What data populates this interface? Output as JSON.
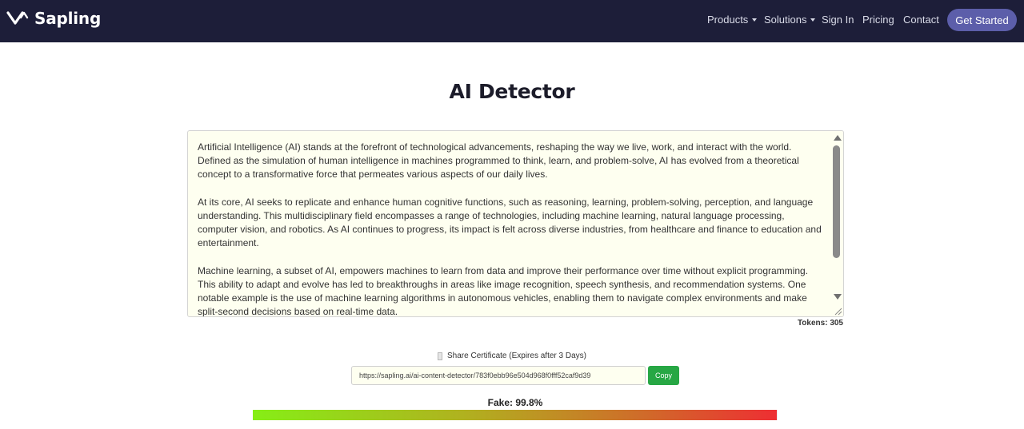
{
  "navbar": {
    "brand": "Sapling",
    "links": [
      {
        "label": "Products",
        "dropdown": true
      },
      {
        "label": "Solutions",
        "dropdown": true
      },
      {
        "label": "Sign In",
        "dropdown": false
      },
      {
        "label": "Pricing",
        "dropdown": false
      },
      {
        "label": "Contact",
        "dropdown": false
      }
    ],
    "cta": "Get Started"
  },
  "page": {
    "title": "AI Detector"
  },
  "input_text": {
    "paragraphs": [
      "Artificial Intelligence (AI) stands at the forefront of technological advancements, reshaping the way we live, work, and interact with the world. Defined as the simulation of human intelligence in machines programmed to think, learn, and problem-solve, AI has evolved from a theoretical concept to a transformative force that permeates various aspects of our daily lives.",
      "At its core, AI seeks to replicate and enhance human cognitive functions, such as reasoning, learning, problem-solving, perception, and language understanding. This multidisciplinary field encompasses a range of technologies, including machine learning, natural language processing, computer vision, and robotics. As AI continues to progress, its impact is felt across diverse industries, from healthcare and finance to education and entertainment.",
      "Machine learning, a subset of AI, empowers machines to learn from data and improve their performance over time without explicit programming. This ability to adapt and evolve has led to breakthroughs in areas like image recognition, speech synthesis, and recommendation systems. One notable example is the use of machine learning algorithms in autonomous vehicles, enabling them to navigate complex environments and make split-second decisions based on real-time data."
    ],
    "tokens_label": "Tokens: 305"
  },
  "share": {
    "label": "Share Certificate (Expires after 3 Days)",
    "checked": false,
    "url": "https://sapling.ai/ai-content-detector/783f0ebb96e504d968f0fff52caf9d39",
    "copy_label": "Copy"
  },
  "result": {
    "label": "Fake: 99.8%",
    "fake_fraction": 0.998
  },
  "colors": {
    "navbar_bg": "#1d1e39",
    "cta_bg": "#5c5eaa",
    "copy_bg": "#27a744",
    "textbox_bg": "#fefff0",
    "meter_start": "#86ee16",
    "meter_end": "#ee2e33"
  }
}
